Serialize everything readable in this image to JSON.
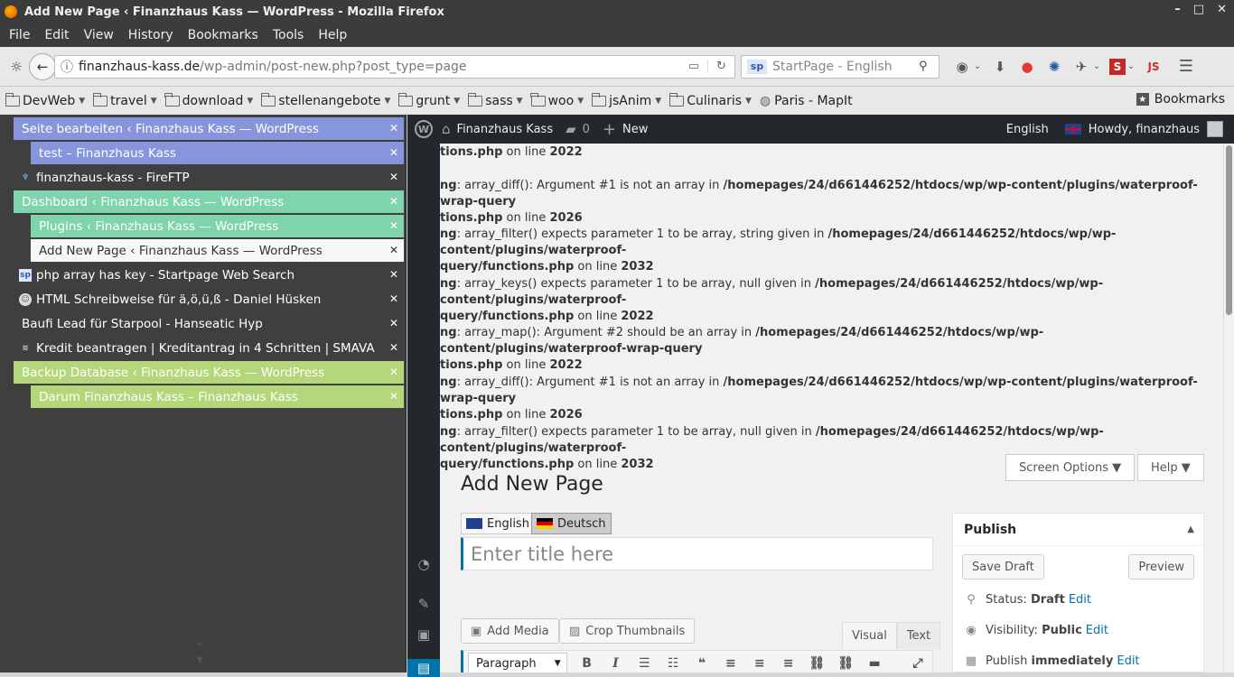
{
  "window": {
    "title": "Add New Page ‹ Finanzhaus Kass — WordPress - Mozilla Firefox",
    "controls": [
      "–",
      "□",
      "✕"
    ]
  },
  "menu": [
    "File",
    "Edit",
    "View",
    "History",
    "Bookmarks",
    "Tools",
    "Help"
  ],
  "nav": {
    "url_host": "finanzhaus-kass.de",
    "url_rest": "/wp-admin/post-new.php?post_type=page",
    "search_placeholder": "StartPage - English",
    "search_engine": "sp"
  },
  "bookmarks": {
    "folders": [
      "DevWeb",
      "travel",
      "download",
      "stellenangebote",
      "grunt",
      "sass",
      "woo",
      "jsAnim",
      "Culinaris"
    ],
    "link": "Paris - MapIt",
    "menu_label": "Bookmarks"
  },
  "tabs": [
    {
      "label": "Seite bearbeiten ‹ Finanzhaus Kass — WordPress",
      "color": "blue"
    },
    {
      "label": "test – Finanzhaus Kass",
      "color": "blue"
    },
    {
      "label": "finanzhaus-kass - FireFTP",
      "color": "dark"
    },
    {
      "label": "Dashboard ‹ Finanzhaus Kass — WordPress",
      "color": "green"
    },
    {
      "label": "Plugins ‹ Finanzhaus Kass — WordPress",
      "color": "green"
    },
    {
      "label": "Add New Page ‹ Finanzhaus Kass — WordPress",
      "color": "white"
    },
    {
      "label": "php array has key - Startpage Web Search",
      "color": "dark"
    },
    {
      "label": "HTML Schreibweise für ä,ö,ü,ß - Daniel Hüsken",
      "color": "dark"
    },
    {
      "label": "Baufi Lead für Starpool - Hanseatic Hyp",
      "color": "dark"
    },
    {
      "label": "Kredit beantragen | Kreditantrag in 4 Schritten | SMAVA",
      "color": "dark"
    },
    {
      "label": "Backup Database ‹ Finanzhaus Kass — WordPress",
      "color": "lime"
    },
    {
      "label": "Darum Finanzhaus Kass – Finanzhaus Kass",
      "color": "lime"
    }
  ],
  "adminbar": {
    "site": "Finanzhaus Kass",
    "comments": "0",
    "new": "New",
    "language": "English",
    "howdy": "Howdy, finanzhaus"
  },
  "warnings": [
    {
      "pre": "",
      "text": "",
      "path": "tions.php",
      "line_label": "on line",
      "line": "2022",
      "single": true
    },
    {
      "pre": "ng",
      "text": ": array_diff(): Argument #1 is not an array in ",
      "path": "/homepages/24/d661446252/htdocs/wp/wp-content/plugins/waterproof-wrap-query",
      "path2": "tions.php",
      "line_label": "on line",
      "line": "2026"
    },
    {
      "pre": "ng",
      "text": ": array_filter() expects parameter 1 to be array, string given in ",
      "path": "/homepages/24/d661446252/htdocs/wp/wp-content/plugins/waterproof-",
      "path2": "query/functions.php",
      "line_label": "on line",
      "line": "2032"
    },
    {
      "pre": "ng",
      "text": ": array_keys() expects parameter 1 to be array, null given in ",
      "path": "/homepages/24/d661446252/htdocs/wp/wp-content/plugins/waterproof-",
      "path2": "query/functions.php",
      "line_label": "on line",
      "line": "2022"
    },
    {
      "pre": "ng",
      "text": ": array_map(): Argument #2 should be an array in ",
      "path": "/homepages/24/d661446252/htdocs/wp/wp-content/plugins/waterproof-wrap-query",
      "path2": "tions.php",
      "line_label": "on line",
      "line": "2022"
    },
    {
      "pre": "ng",
      "text": ": array_diff(): Argument #1 is not an array in ",
      "path": "/homepages/24/d661446252/htdocs/wp/wp-content/plugins/waterproof-wrap-query",
      "path2": "tions.php",
      "line_label": "on line",
      "line": "2026"
    },
    {
      "pre": "ng",
      "text": ": array_filter() expects parameter 1 to be array, null given in ",
      "path": "/homepages/24/d661446252/htdocs/wp/wp-content/plugins/waterproof-",
      "path2": "query/functions.php",
      "line_label": "on line",
      "line": "2032"
    }
  ],
  "screen_options": "Screen Options ▼",
  "help": "Help ▼",
  "page_title": "Add New Page",
  "languages": [
    {
      "label": "English",
      "active": false
    },
    {
      "label": "Deutsch",
      "active": true
    }
  ],
  "title_placeholder": "Enter title here",
  "add_media": "Add Media",
  "crop_thumbnails": "Crop Thumbnails",
  "editor_tabs": {
    "visual": "Visual",
    "text": "Text"
  },
  "format_select": "Paragraph",
  "publish": {
    "heading": "Publish",
    "save_draft": "Save Draft",
    "preview": "Preview",
    "status_label": "Status:",
    "status_value": "Draft",
    "visibility_label": "Visibility:",
    "visibility_value": "Public",
    "publish_label": "Publish",
    "publish_value": "immediately",
    "edit": "Edit"
  }
}
